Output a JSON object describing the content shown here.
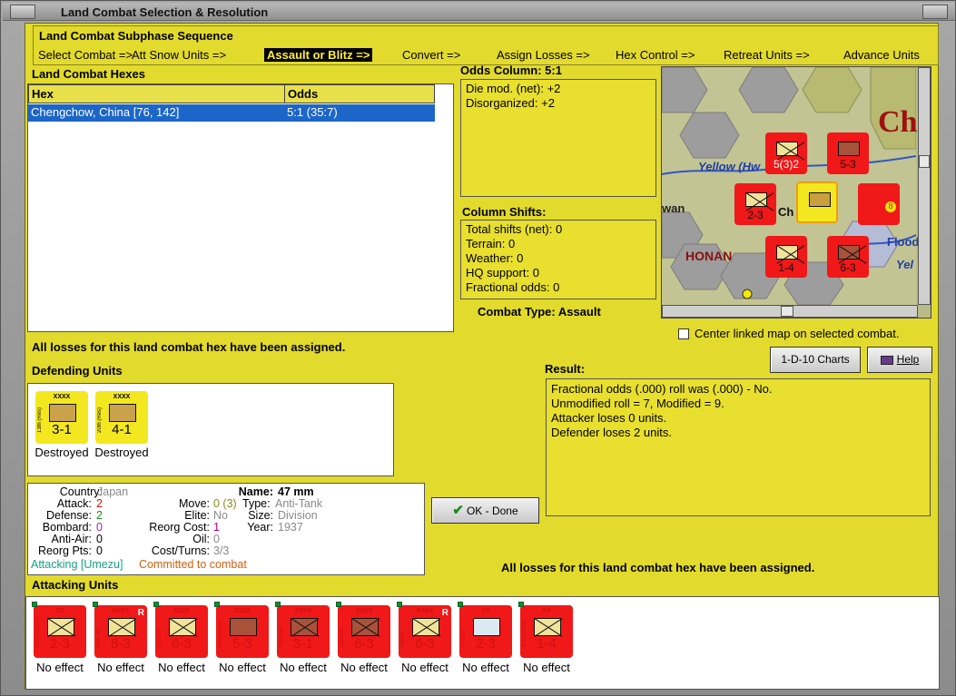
{
  "window": {
    "title": "Land Combat Selection & Resolution"
  },
  "subphase": {
    "heading": "Land Combat Subphase Sequence",
    "steps": [
      {
        "label": "Select Combat =>",
        "active": false
      },
      {
        "label": "Att Snow Units =>",
        "active": false
      },
      {
        "label": "Assault or Blitz =>",
        "active": true
      },
      {
        "label": "Convert =>",
        "active": false
      },
      {
        "label": "Assign Losses =>",
        "active": false
      },
      {
        "label": "Hex Control =>",
        "active": false
      },
      {
        "label": "Retreat Units =>",
        "active": false
      },
      {
        "label": "Advance Units",
        "active": false
      }
    ]
  },
  "hexes": {
    "heading": "Land Combat Hexes",
    "columns": [
      "Hex",
      "Odds"
    ],
    "rows": [
      {
        "hex": "Chengchow, China [76, 142]",
        "odds": "5:1 (35:7)"
      }
    ]
  },
  "odds": {
    "heading": "Odds Column: 5:1",
    "lines": [
      "Die mod. (net): +2",
      "Disorganized: +2"
    ]
  },
  "shifts": {
    "heading": "Column Shifts:",
    "lines": [
      "Total shifts (net): 0",
      "Terrain: 0",
      "Weather: 0",
      "HQ support: 0",
      "Fractional odds: 0"
    ]
  },
  "combat_type": "Combat Type:  Assault",
  "map": {
    "labels": {
      "city": "Ch",
      "big": "Ch",
      "river": "Yellow (Hw",
      "province": "HONAN",
      "flood": "Flood",
      "yel": "Yel",
      "wan": "wan"
    },
    "center_checkbox": "Center linked map on selected combat."
  },
  "losses_message": "All losses for this land combat hex have been assigned.",
  "buttons": {
    "charts": "1-D-10 Charts",
    "help": "Help",
    "ok": "OK - Done"
  },
  "defending": {
    "heading": "Defending Units",
    "units": [
      {
        "size": "XXXX",
        "name": "13th (Res)",
        "vals": "3-1",
        "status": "Destroyed"
      },
      {
        "size": "XXXX",
        "name": "20th (Res)",
        "vals": "4-1",
        "status": "Destroyed"
      }
    ]
  },
  "result": {
    "heading": "Result:",
    "lines": [
      "Fractional odds (.000) roll was (.000)  - No.",
      "Unmodified roll = 7, Modified = 9.",
      "Attacker loses 0 units.",
      "Defender loses 2 units."
    ]
  },
  "unit_info": {
    "country_label": "Country:",
    "country": "Japan",
    "attack_label": "Attack:",
    "attack": "2",
    "defense_label": "Defense:",
    "defense": "2",
    "bombard_label": "Bombard:",
    "bombard": "0",
    "antiair_label": "Anti-Air:",
    "antiair": "0",
    "reorg_label": "Reorg Pts:",
    "reorg": "0",
    "name_label": "Name:",
    "name": "47 mm",
    "move_label": "Move:",
    "move": "0 (3)",
    "type_label": "Type:",
    "type": "Anti-Tank",
    "elite_label": "Elite:",
    "elite": "No",
    "size_label": "Size:",
    "size": "Division",
    "reorgcost_label": "Reorg Cost:",
    "reorgcost": "1",
    "year_label": "Year:",
    "year": "1937",
    "oil_label": "Oil:",
    "oil": "0",
    "costturns_label": "Cost/Turns:",
    "costturns": "3/3",
    "attacking": "Attacking [Umezu]",
    "committed": "Committed to combat"
  },
  "attacking": {
    "heading": "Attacking Units",
    "units": [
      {
        "size": "XX",
        "name": "2nd Ind Bde",
        "vals": "2-3",
        "status": "No effect",
        "style": "x",
        "r": false
      },
      {
        "size": "XXXX",
        "name": "25th Inf",
        "vals": "8-3",
        "status": "No effect",
        "style": "x",
        "r": true
      },
      {
        "size": "XXXX",
        "name": "11th Inf",
        "vals": "6-3",
        "status": "No effect",
        "style": "x",
        "r": false
      },
      {
        "size": "XXXX",
        "name": "Hiroshima",
        "vals": "5-3",
        "status": "No effect",
        "style": "m",
        "r": false
      },
      {
        "size": "XXXX",
        "name": "29th Gar",
        "vals": "3-1",
        "status": "No effect",
        "style": "gar",
        "r": false
      },
      {
        "size": "XXXX",
        "name": "23rd Inf",
        "vals": "6-3",
        "status": "No effect",
        "style": "brx",
        "r": false
      },
      {
        "size": "XXXX",
        "name": "6th Inf",
        "vals": "6-3",
        "status": "No effect",
        "style": "x",
        "r": true
      },
      {
        "size": "XX",
        "name": "47 mm",
        "vals": "2-3",
        "status": "No effect",
        "style": "at",
        "r": false
      },
      {
        "size": "XX",
        "name": "3rd Ind Div",
        "vals": "1-4",
        "status": "No effect",
        "style": "x",
        "r": false
      }
    ]
  },
  "colors": {
    "panel": "#e2da2c",
    "counter_red": "#f01818",
    "counter_yellow": "#f3e820",
    "selection": "#1c66c9"
  }
}
